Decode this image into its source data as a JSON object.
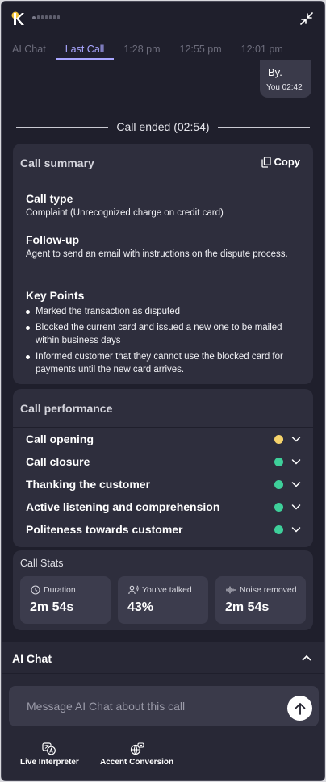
{
  "tabs": [
    {
      "label": "AI Chat",
      "active": false
    },
    {
      "label": "Last Call",
      "active": true
    },
    {
      "label": "1:28 pm",
      "active": false
    },
    {
      "label": "12:55 pm",
      "active": false
    },
    {
      "label": "12:01 pm",
      "active": false
    }
  ],
  "chat_message": {
    "text": "By.",
    "meta": "You 02:42"
  },
  "call_ended": "Call ended (02:54)",
  "summary": {
    "title": "Call summary",
    "copy_label": "Copy",
    "call_type_title": "Call type",
    "call_type_body": "Complaint (Unrecognized charge on credit card)",
    "followup_title": "Follow-up",
    "followup_body": "Agent to send an email with instructions on the dispute process.",
    "key_points_title": "Key Points",
    "key_points": [
      "Marked the transaction as disputed",
      "Blocked the current card and issued a new one to be mailed within business days",
      "Informed customer that they cannot use the blocked card for payments until the new card arrives."
    ]
  },
  "performance": {
    "title": "Call performance",
    "items": [
      {
        "label": "Call opening",
        "status_color": "#f5d36b"
      },
      {
        "label": "Call closure",
        "status_color": "#3ecf9a"
      },
      {
        "label": "Thanking the customer",
        "status_color": "#3ecf9a"
      },
      {
        "label": "Active listening and comprehension",
        "status_color": "#3ecf9a"
      },
      {
        "label": "Politeness towards customer",
        "status_color": "#3ecf9a"
      }
    ]
  },
  "stats": {
    "title": "Call Stats",
    "items": [
      {
        "label": "Duration",
        "value": "2m 54s",
        "icon": "clock-icon"
      },
      {
        "label": "You've talked",
        "value": "43%",
        "icon": "people-icon"
      },
      {
        "label": "Noise removed",
        "value": "2m 54s",
        "icon": "waveform-icon"
      }
    ]
  },
  "ai_chat": {
    "title": "AI Chat",
    "placeholder": "Message AI Chat about this call",
    "tools": [
      {
        "label": "Live Interpreter",
        "icon": "translate-icon"
      },
      {
        "label": "Accent Conversion",
        "icon": "accent-icon"
      }
    ]
  },
  "colors": {
    "accent": "#a9a6ff",
    "background": "#1f1f2c",
    "card": "#2e2e3d"
  }
}
